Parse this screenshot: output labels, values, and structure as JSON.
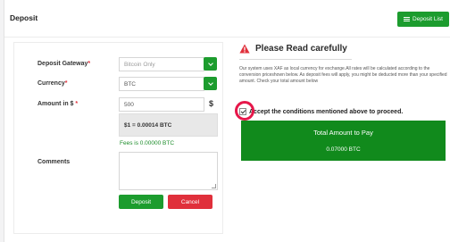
{
  "header": {
    "title": "Deposit",
    "list_button_label": "Deposit List"
  },
  "form": {
    "gateway_label": "Deposit Gateway",
    "gateway_value": "Bitcoin Only",
    "currency_label": "Currency",
    "currency_value": "BTC",
    "amount_label": "Amount in $",
    "amount_value": "500",
    "amount_unit": "$",
    "required_mark": "*",
    "rate_text": "$1 = 0.00014 BTC",
    "fees_text": "Fees is 0.00000 BTC",
    "comments_label": "Comments",
    "comments_value": "",
    "deposit_button": "Deposit",
    "cancel_button": "Cancel"
  },
  "notice": {
    "title": "Please Read carefully",
    "text": "Our system uses XAF as local currency for exchange.All rates will be calculated according to the conversion priceshown below. As deposit fees will apply, you might be deducted more than your specified amount. Check your total amount below",
    "accept_label": "Accept the conditions mentioned above to proceed.",
    "accept_checked": true,
    "total_label": "Total Amount to Pay",
    "total_value": "0.07000 BTC"
  },
  "colors": {
    "primary_green": "#1c9c2e",
    "total_green": "#118a1c",
    "danger_red": "#e0303b",
    "highlight_ring": "#e6174a"
  }
}
